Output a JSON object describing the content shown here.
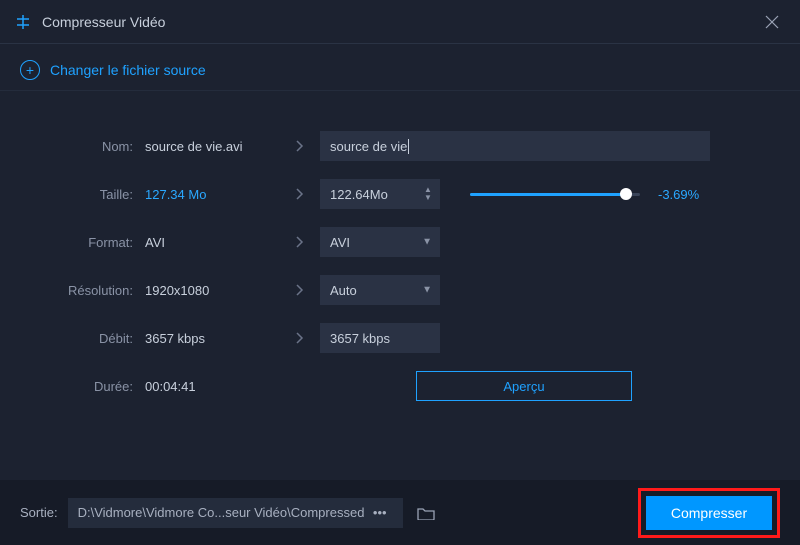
{
  "titlebar": {
    "title": "Compresseur Vidéo"
  },
  "changeSource": {
    "label": "Changer le fichier source"
  },
  "rows": {
    "name": {
      "label": "Nom:",
      "current": "source de vie.avi",
      "input": "source de vie"
    },
    "size": {
      "label": "Taille:",
      "current": "127.34 Mo",
      "input": "122.64Mo",
      "percent": "-3.69%"
    },
    "format": {
      "label": "Format:",
      "current": "AVI",
      "input": "AVI"
    },
    "res": {
      "label": "Résolution:",
      "current": "1920x1080",
      "input": "Auto"
    },
    "bitrate": {
      "label": "Débit:",
      "current": "3657 kbps",
      "input": "3657 kbps"
    },
    "duration": {
      "label": "Durée:",
      "current": "00:04:41"
    }
  },
  "preview": {
    "label": "Aperçu"
  },
  "output": {
    "label": "Sortie:",
    "path": "D:\\Vidmore\\Vidmore Co...seur Vidéo\\Compressed"
  },
  "compress": {
    "label": "Compresser"
  }
}
